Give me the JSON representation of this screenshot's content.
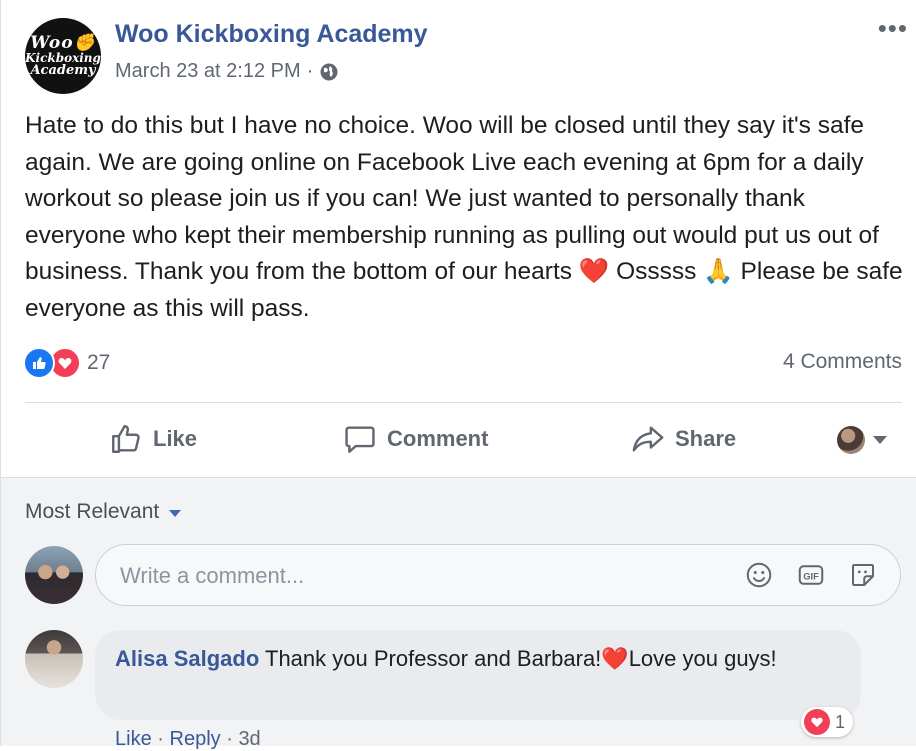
{
  "post": {
    "page_name": "Woo Kickboxing Academy",
    "avatar_text": {
      "line1": "Woo",
      "line2": "Kickboxing",
      "line3": "Academy"
    },
    "timestamp": "March 23 at 2:12 PM",
    "separator": "·",
    "privacy_icon": "globe-icon",
    "more_label": "•••",
    "text": "Hate to do this but I have no choice. Woo will be closed until they say it's safe again. We are going online on Facebook Live each evening at 6pm for a daily workout so please join us if you can! We just wanted to personally thank everyone who kept their membership running as pulling out would put us out of business. Thank you from the bottom of our hearts ❤️ Osssss 🙏 Please be safe everyone as this will pass."
  },
  "reactions": {
    "icons": [
      "like-icon",
      "love-icon"
    ],
    "count": "27",
    "comments_count": "4 Comments"
  },
  "actions": {
    "like_label": "Like",
    "comment_label": "Comment",
    "share_label": "Share"
  },
  "comments": {
    "sort_label": "Most Relevant",
    "input_placeholder": "Write a comment...",
    "input_icons": [
      "emoji-icon",
      "gif-icon",
      "sticker-icon"
    ],
    "items": [
      {
        "author": "Alisa Salgado",
        "text": "Thank you Professor and Barbara!❤️Love you guys!",
        "reaction_count": "1",
        "actions": {
          "like": "Like",
          "reply": "Reply",
          "time": "3d",
          "sep": "·"
        }
      }
    ]
  },
  "colors": {
    "link_blue": "#385898",
    "like_blue": "#1877f2",
    "love_red": "#f33e58",
    "muted_gray": "#606770"
  }
}
